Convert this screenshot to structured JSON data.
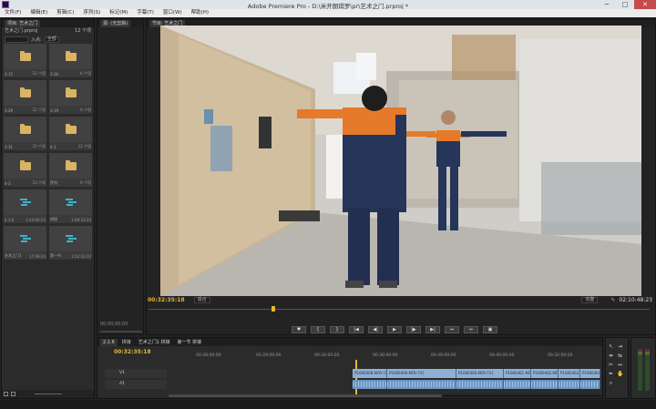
{
  "window": {
    "title": "Adobe Premiere Pro - D:\\米开朗琪罗\\pr\\艺术之门.prproj *"
  },
  "menu": [
    "文件(F)",
    "编辑(E)",
    "剪辑(C)",
    "序列(S)",
    "标记(M)",
    "字幕(T)",
    "窗口(W)",
    "帮助(H)"
  ],
  "project": {
    "tab_label": "项目: 艺术之门",
    "file_name": "艺术之门.prproj",
    "item_count": "12 个项",
    "search_label": "入点:",
    "search_dropdown": "全部",
    "items": [
      {
        "label": "3-15",
        "count": "12 个项",
        "type": "folder"
      },
      {
        "label": "3-36",
        "count": "6 个项",
        "type": "folder"
      },
      {
        "label": "3-29",
        "count": "12 个项",
        "type": "folder"
      },
      {
        "label": "3-19",
        "count": "6 个项",
        "type": "folder"
      },
      {
        "label": "3-31",
        "count": "12 个项",
        "type": "folder"
      },
      {
        "label": "4-1",
        "count": "12 个项",
        "type": "folder"
      },
      {
        "label": "4-3",
        "count": "13 个项",
        "type": "folder"
      },
      {
        "label": "序列",
        "count": "6 个项",
        "type": "folder"
      },
      {
        "label": "2.1.6",
        "count": "1:03:06:23",
        "type": "sequence"
      },
      {
        "label": "拼接",
        "count": "1:09:23:20",
        "type": "sequence"
      },
      {
        "label": "艺术之门1",
        "count": "17:08:24",
        "type": "sequence"
      },
      {
        "label": "第一节",
        "count": "1:02:03:10",
        "type": "sequence"
      }
    ]
  },
  "source": {
    "tab_label": "源: (无剪辑)",
    "timecode": "00;00;00;00"
  },
  "program": {
    "tab_label": "节目: 艺术之门",
    "timecode": "00:32:35:18",
    "fit": "适合",
    "quality": "完整",
    "duration": "02:10:48:23"
  },
  "transport": [
    "♥",
    "{",
    "}",
    "|◀",
    "◀|",
    "▶",
    "|▶",
    "▶|",
    "⇔",
    "⇔",
    "▣"
  ],
  "timeline": {
    "tabs": [
      "2.1.6",
      "拼接",
      "艺术之门1 拼接",
      "第一节 拼接"
    ],
    "timecode": "00:32:35:18",
    "ruler": [
      "00:28:00:00",
      "00:29:00:00",
      "00:30:00:00",
      "00:36:00:00",
      "00:48:00:00",
      "00:40:00:00",
      "00:32:00:00"
    ],
    "tracks": [
      {
        "name": "V1",
        "kind": "video"
      },
      {
        "name": "A1",
        "kind": "audio"
      }
    ],
    "video_clips": [
      "P1000408.MOV [V]",
      "P1000409.MOV [V]",
      "P1000460.MOV [V]",
      "P1000461.MOV",
      "P1000462.MOV",
      "P1000463.MOV",
      "P1000464.MOV"
    ]
  }
}
